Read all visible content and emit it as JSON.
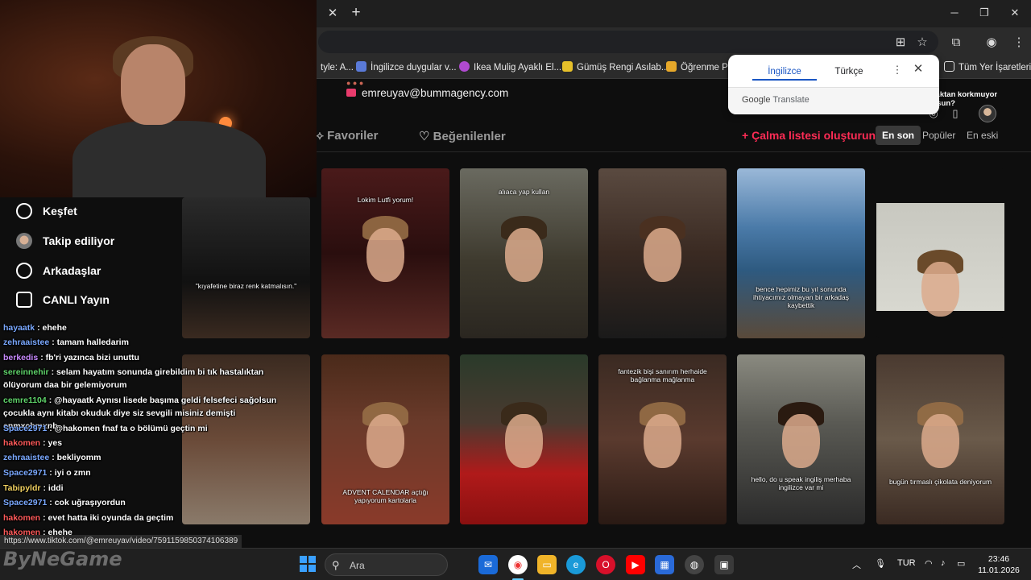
{
  "browser": {
    "bookmarks": [
      "tyle: A...",
      "İngilizce duygular v...",
      "Ikea Mulig Ayaklı El...",
      "Gümüş Rengi Asılab...",
      "Öğrenme Par",
      "Tüm Yer İşaretleri"
    ],
    "status_url": "https://www.tiktok.com/@emreuyav/video/7591159850374106389"
  },
  "translate_popup": {
    "source_lang": "İngilizce",
    "target_lang": "Türkçe",
    "brand": "Google",
    "brand_suffix": "Translate"
  },
  "profile": {
    "email": "emreuyav@bummagency.com",
    "tabs": [
      "Favoriler",
      "Beğenilenler"
    ],
    "create_playlist": "Çalma listesi oluşturun",
    "sort_options": [
      "En son",
      "Popüler",
      "En eski"
    ],
    "active_sort": "En son"
  },
  "nav": {
    "items": [
      "Keşfet",
      "Takip ediliyor",
      "Arkadaşlar",
      "CANLI Yayın"
    ]
  },
  "videos": [
    {
      "caption": "\"kıyafetine biraz renk katmalısın.\""
    },
    {
      "caption": "Lokim Lutfi yorum!"
    },
    {
      "caption": "alıaca yap kullan"
    },
    {
      "caption": ""
    },
    {
      "caption": "bence hepimiz bu yıl sonunda ihtiyacımız olmayan bir arkadaş kaybettik"
    },
    {
      "caption": "\"başarısız olmaktan korkmuyor musun?"
    },
    {
      "caption": ""
    },
    {
      "caption": "ADVENT CALENDAR açtığı yapıyorum kartolarla"
    },
    {
      "caption": ""
    },
    {
      "caption": "fantezik bişi sanırım herhaide bağlanma mağlanma"
    },
    {
      "caption": "hello, do u speak ingiliş merhaba ingilizce var mi"
    },
    {
      "caption": "bugün tırmaslı çikolata deniyorum"
    }
  ],
  "chat": [
    {
      "user": "hayaatk",
      "msg": ": ehehe",
      "color": "#7aa8ff"
    },
    {
      "user": "zehraaistee",
      "msg": ": tamam halledarim",
      "color": "#7aa8ff"
    },
    {
      "user": "berkedis",
      "msg": ": fb'ri yazınca bizi unuttu",
      "color": "#c98bff"
    },
    {
      "user": "sereinnehir",
      "msg": ": selam hayatım sonunda girebildim bi tık hastalıktan ölüyorum daa bir gelemiyorum",
      "color": "#5fd36a"
    },
    {
      "user": "cemre1104",
      "msg": ": @hayaatk Aynısı lisede başıma geldi felsefeci sağolsun çocukla aynı kitabı okuduk diye siz sevgili misiniz demişti cnmxcbmxnb",
      "color": "#5fd36a"
    },
    {
      "user": "Space2971",
      "msg": ": @hakomen fnaf ta o bölümü geçtin mi",
      "color": "#7aa8ff"
    },
    {
      "user": "hakomen",
      "msg": ": yes",
      "color": "#ff5a5a"
    },
    {
      "user": "zehraaistee",
      "msg": ": bekliyomm",
      "color": "#7aa8ff"
    },
    {
      "user": "Space2971",
      "msg": ": iyi o zmn",
      "color": "#7aa8ff"
    },
    {
      "user": "Tabipyldr",
      "msg": ": iddi",
      "color": "#f0d060"
    },
    {
      "user": "Space2971",
      "msg": ": cok uğraşıyordun",
      "color": "#7aa8ff"
    },
    {
      "user": "hakomen",
      "msg": ": evet hatta iki oyunda da geçtim",
      "color": "#ff5a5a"
    },
    {
      "user": "hakomen",
      "msg": ": ehehe",
      "color": "#ff5a5a"
    }
  ],
  "watermark": "ByNeGame",
  "taskbar": {
    "search_placeholder": "Ara",
    "lang": "TUR",
    "time": "23:46",
    "date": "11.01.2026"
  }
}
